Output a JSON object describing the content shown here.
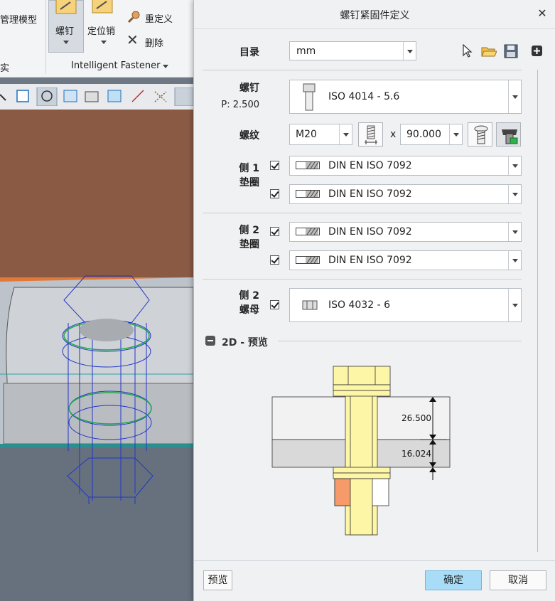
{
  "app": {
    "ribbon_left_text_1": "管理模型",
    "ribbon_left_text_2": "实",
    "screw_button_label": "螺钉",
    "dowel_button_label": "定位销",
    "redefine_label": "重定义",
    "delete_label": "删除",
    "group_label": "Intelligent Fastener"
  },
  "dialog": {
    "title": "螺钉紧固件定义",
    "catalog_label": "目录",
    "catalog_value": "mm",
    "screw_label": "螺钉",
    "pitch_label": "P: 2.500",
    "screw_value": "ISO 4014 - 5.6",
    "thread_label": "螺纹",
    "thread_size": "M20",
    "times_label": "x",
    "thread_length": "90.000",
    "side1_label_a": "侧 1",
    "side1_label_b": "垫圈",
    "side1_washer1": "DIN EN ISO 7092",
    "side1_washer2": "DIN EN ISO 7092",
    "side2_label_a": "侧 2",
    "side2_label_b": "垫圈",
    "side2_washer1": "DIN EN ISO 7092",
    "side2_washer2": "DIN EN ISO 7092",
    "side2_nut_label_a": "侧 2",
    "side2_nut_label_b": "螺母",
    "nut_value": "ISO 4032 - 6",
    "preview_section": "2D - 预览",
    "dim_top": "26.500",
    "dim_bottom": "16.024",
    "preview_button": "预览",
    "ok_button": "确定",
    "cancel_button": "取消"
  },
  "colors": {
    "bolt_yellow": "#fdf6a6",
    "nut_orange": "#f79a6a",
    "ok_blue": "#a9dcf7",
    "plate_top": "#f2f2f2",
    "plate_bottom": "#d9d9d9"
  }
}
